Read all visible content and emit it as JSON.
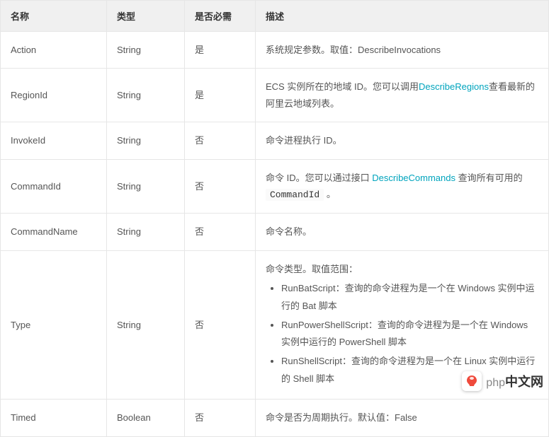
{
  "headers": {
    "name": "名称",
    "type": "类型",
    "required": "是否必需",
    "description": "描述"
  },
  "rows": [
    {
      "name": "Action",
      "type": "String",
      "required": "是",
      "desc_kind": "plain",
      "desc_text": "系统规定参数。取值：DescribeInvocations"
    },
    {
      "name": "RegionId",
      "type": "String",
      "required": "是",
      "desc_kind": "regionid",
      "part1": "ECS 实例所在的地域 ID。您可以调用",
      "link": "DescribeRegions",
      "part2": "查看最新的阿里云地域列表。"
    },
    {
      "name": "InvokeId",
      "type": "String",
      "required": "否",
      "desc_kind": "plain",
      "desc_text": "命令进程执行 ID。"
    },
    {
      "name": "CommandId",
      "type": "String",
      "required": "否",
      "desc_kind": "commandid",
      "part1": "命令 ID。您可以通过接口 ",
      "link": "DescribeCommands",
      "part2": " 查询所有可用的 ",
      "code": "CommandId",
      "part3": " 。"
    },
    {
      "name": "CommandName",
      "type": "String",
      "required": "否",
      "desc_kind": "plain",
      "desc_text": "命令名称。"
    },
    {
      "name": "Type",
      "type": "String",
      "required": "否",
      "desc_kind": "typelist",
      "intro": "命令类型。取值范围：",
      "items": [
        "RunBatScript：查询的命令进程为是一个在 Windows 实例中运行的 Bat 脚本",
        "RunPowerShellScript：查询的命令进程为是一个在 Windows 实例中运行的 PowerShell 脚本",
        "RunShellScript：查询的命令进程为是一个在 Linux 实例中运行的 Shell 脚本"
      ]
    },
    {
      "name": "Timed",
      "type": "Boolean",
      "required": "否",
      "desc_kind": "plain",
      "desc_text": "命令是否为周期执行。默认值：False"
    }
  ],
  "watermark": {
    "text": "中文网",
    "prefix": "php"
  }
}
